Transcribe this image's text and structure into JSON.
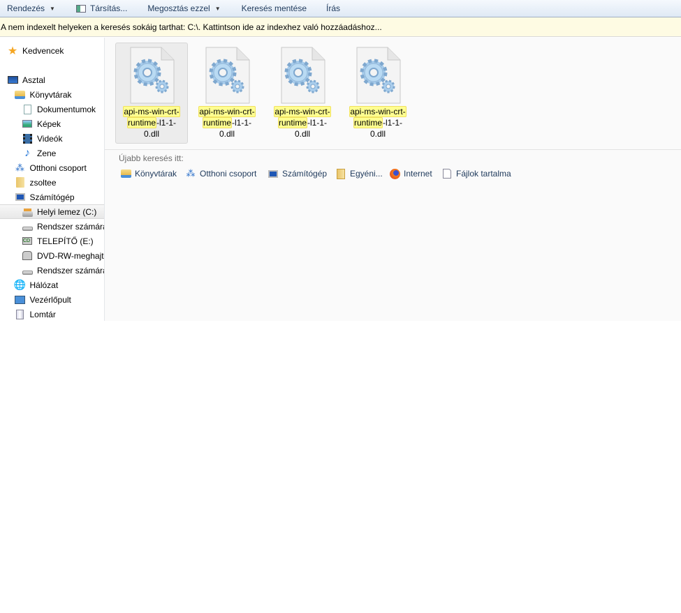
{
  "toolbar": {
    "organize": "Rendezés",
    "associate": "Társítás...",
    "share": "Megosztás ezzel",
    "save_search": "Keresés mentése",
    "burn": "Írás"
  },
  "infobar": {
    "text": "A nem indexelt helyeken a keresés sokáig tarthat: C:\\. Kattintson ide az indexhez való hozzáadáshoz..."
  },
  "sidebar": {
    "items": [
      {
        "label": "Kedvencek",
        "icon": "star-icon"
      },
      {
        "label": "Asztal",
        "icon": "desktop-icon"
      },
      {
        "label": "Könyvtárak",
        "icon": "libraries-icon"
      },
      {
        "label": "Dokumentumok",
        "icon": "documents-icon"
      },
      {
        "label": "Képek",
        "icon": "pictures-icon"
      },
      {
        "label": "Videók",
        "icon": "videos-icon"
      },
      {
        "label": "Zene",
        "icon": "music-icon"
      },
      {
        "label": "Otthoni csoport",
        "icon": "homegroup-icon"
      },
      {
        "label": "zsoltee",
        "icon": "user-folder-icon"
      },
      {
        "label": "Számítógép",
        "icon": "computer-icon"
      },
      {
        "label": "Helyi lemez (C:)",
        "icon": "local-disk-icon"
      },
      {
        "label": "Rendszer számára",
        "icon": "drive-icon"
      },
      {
        "label": "TELEPÍTŐ (E:)",
        "icon": "cd-drive-icon"
      },
      {
        "label": "DVD-RW-meghajt",
        "icon": "dvd-drive-icon"
      },
      {
        "label": "Rendszer számára",
        "icon": "drive-icon"
      },
      {
        "label": "Hálózat",
        "icon": "network-icon"
      },
      {
        "label": "Vezérlőpult",
        "icon": "control-panel-icon"
      },
      {
        "label": "Lomtár",
        "icon": "recycle-bin-icon"
      }
    ]
  },
  "files": [
    {
      "hl1": "api-ms-win-crt-",
      "hl2": "runtime",
      "rest2": "-l1-1-",
      "line3": "0.dll"
    },
    {
      "hl1": "api-ms-win-crt-",
      "hl2": "runtime",
      "rest2": "-l1-1-",
      "line3": "0.dll"
    },
    {
      "hl1": "api-ms-win-crt-",
      "hl2": "runtime",
      "rest2": "-l1-1-",
      "line3": "0.dll"
    },
    {
      "hl1": "api-ms-win-crt-",
      "hl2": "runtime",
      "rest2": "-l1-1-",
      "line3": "0.dll"
    }
  ],
  "search_again": {
    "label": "Újabb keresés itt:",
    "items": [
      {
        "label": "Könyvtárak",
        "icon": "libraries-icon"
      },
      {
        "label": "Otthoni csoport",
        "icon": "homegroup-icon"
      },
      {
        "label": "Számítógép",
        "icon": "computer-icon"
      },
      {
        "label": "Egyéni...",
        "icon": "custom-folder-icon"
      },
      {
        "label": "Internet",
        "icon": "firefox-icon"
      },
      {
        "label": "Fájlok tartalma",
        "icon": "file-contents-icon"
      }
    ]
  }
}
